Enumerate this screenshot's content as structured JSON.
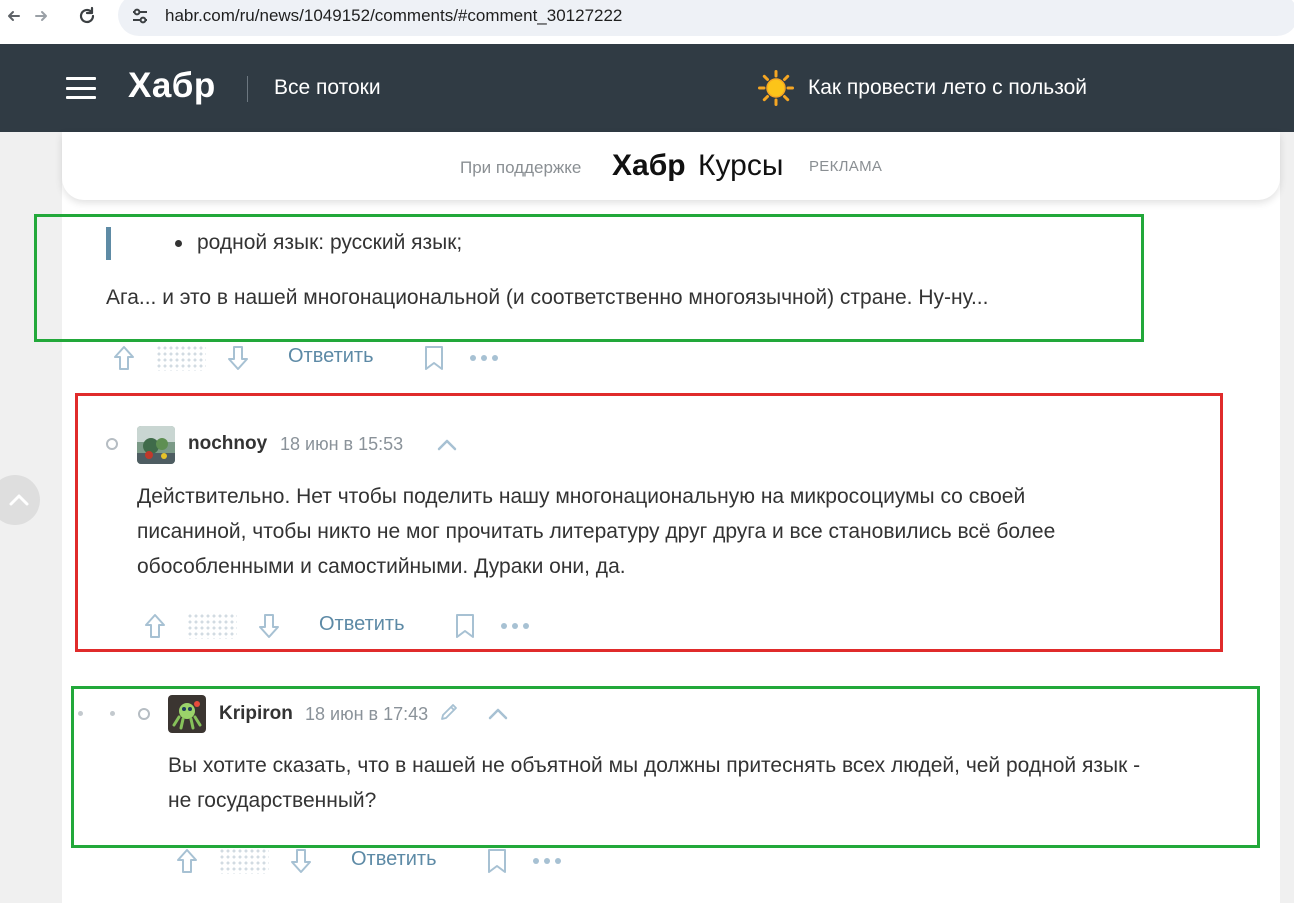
{
  "browser": {
    "url": "habr.com/ru/news/1049152/comments/#comment_30127222"
  },
  "header": {
    "logo": "Хабр",
    "flows_label": "Все потоки",
    "promo_text": "Как провести лето с пользой",
    "promo_icon": "sun-icon"
  },
  "sponsor": {
    "support_label": "При поддержке",
    "brand": "Хабр",
    "brand_suffix": "Курсы",
    "ad_label": "РЕКЛАМА"
  },
  "colors": {
    "header_bg": "#303b44",
    "highlight_green": "#22a83a",
    "highlight_red": "#e02b2b",
    "reply_link": "#5d8aa6",
    "vote_icon": "#a7c1d3"
  },
  "comments": [
    {
      "quote": "родной язык: русский язык;",
      "text": "Ага... и это в нашей многонациональной (и соответственно многоязычной) стране. Ну-ну...",
      "reply_label": "Ответить"
    },
    {
      "author": "nochnoy",
      "timestamp": "18 июн в 15:53",
      "text_lines": [
        "Действительно. Нет чтобы поделить нашу многонациональную на микросоциумы со своей",
        "писаниной, чтобы никто не мог прочитать литературу друг друга и все становились всё более",
        "обособленными и самостийными. Дураки они, да."
      ],
      "reply_label": "Ответить"
    },
    {
      "author": "Kripiron",
      "timestamp": "18 июн в 17:43",
      "text_lines": [
        "Вы хотите сказать, что в нашей не объятной мы должны притеснять всех людей, чей родной язык -",
        "не государственный?"
      ],
      "reply_label": "Ответить"
    }
  ]
}
